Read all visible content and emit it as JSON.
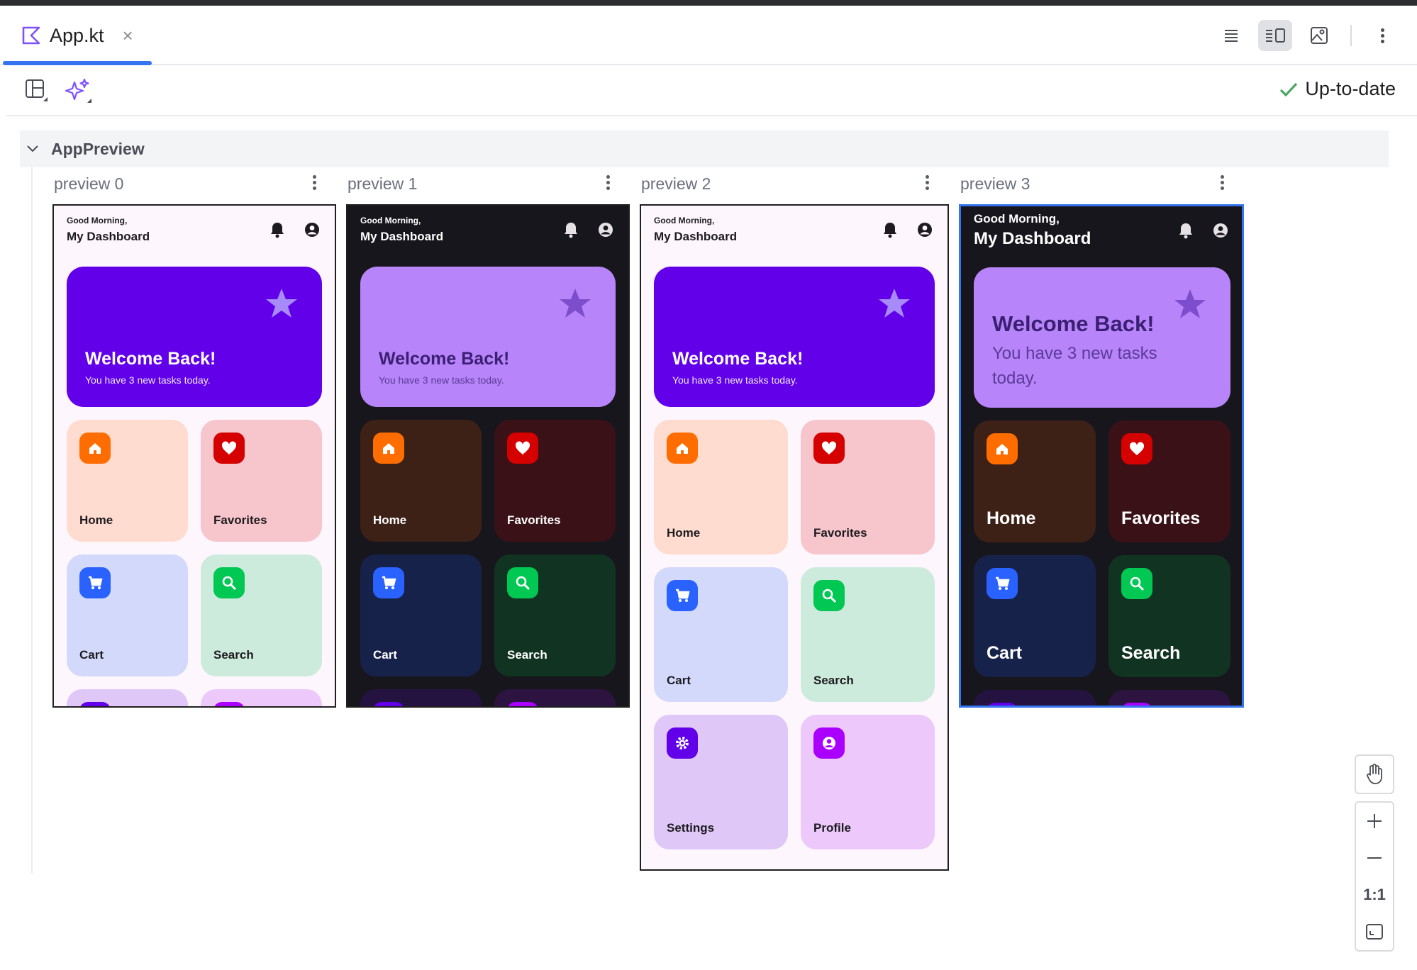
{
  "editor": {
    "tab_title": "App.kt",
    "close_glyph": "×",
    "status": "Up-to-date"
  },
  "group": {
    "title": "AppPreview"
  },
  "previews": [
    {
      "label": "preview 0",
      "theme": "light"
    },
    {
      "label": "preview 1",
      "theme": "dark"
    },
    {
      "label": "preview 2",
      "theme": "light"
    },
    {
      "label": "preview 3",
      "theme": "dark",
      "selected": true
    }
  ],
  "app": {
    "greeting": "Good Morning,",
    "title": "My Dashboard",
    "hero_title": "Welcome Back!",
    "hero_subtitle": "You have 3 new tasks today.",
    "cards": [
      {
        "label": "Home",
        "icon": "home-icon",
        "icon_color": "#ff6d00",
        "light_bg": "#ffdccf",
        "dark_bg": "#3e2116"
      },
      {
        "label": "Favorites",
        "icon": "heart-icon",
        "icon_color": "#d50000",
        "light_bg": "#f7c6cc",
        "dark_bg": "#3a1116"
      },
      {
        "label": "Cart",
        "icon": "cart-icon",
        "icon_color": "#2962ff",
        "light_bg": "#d3d9fb",
        "dark_bg": "#17224b"
      },
      {
        "label": "Search",
        "icon": "search-icon",
        "icon_color": "#00c853",
        "light_bg": "#cdebdc",
        "dark_bg": "#113422"
      },
      {
        "label": "Settings",
        "icon": "gear-icon",
        "icon_color": "#6200ea",
        "light_bg": "#dfc8f7",
        "dark_bg": "#241340"
      },
      {
        "label": "Profile",
        "icon": "account-icon",
        "icon_color": "#aa00ff",
        "light_bg": "#ecc8fb",
        "dark_bg": "#2d1440"
      }
    ]
  },
  "colors": {
    "light_bg": "#fdf6fd",
    "dark_bg": "#17161c",
    "hero_light": "#6200ea",
    "hero_dark": "#b784f9",
    "accent": "#3574f0"
  },
  "zoom": {
    "actual_size_label": "1:1"
  }
}
